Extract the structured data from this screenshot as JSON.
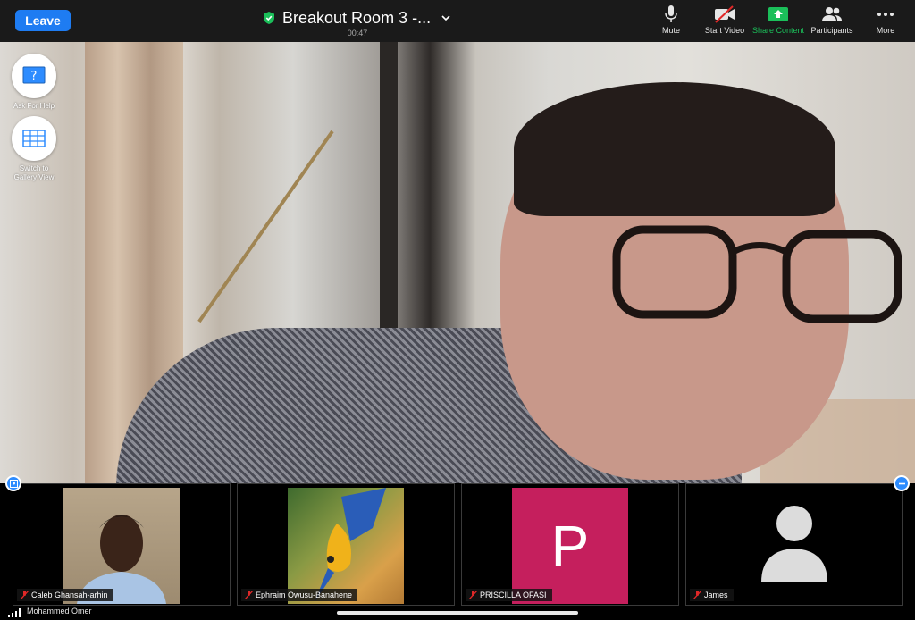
{
  "topbar": {
    "leave_label": "Leave",
    "room_title": "Breakout Room 3 -...",
    "timer": "00:47",
    "buttons": [
      {
        "label": "Mute",
        "icon": "microphone-icon"
      },
      {
        "label": "Start Video",
        "icon": "video-off-icon"
      },
      {
        "label": "Share Content",
        "icon": "share-screen-icon"
      },
      {
        "label": "Participants",
        "icon": "participants-icon"
      },
      {
        "label": "More",
        "icon": "more-dots-icon"
      }
    ]
  },
  "side": {
    "ask_help": "Ask For Help",
    "gallery": "Switch to\nGallery View"
  },
  "thumbnails": [
    {
      "name": "Caleb Ghansah-arhin",
      "type": "video"
    },
    {
      "name": "Ephraim Owusu-Banahene",
      "type": "image"
    },
    {
      "name": "PRISCILLA OFASI",
      "type": "initial",
      "initial": "P"
    },
    {
      "name": "James",
      "type": "avatar"
    }
  ],
  "self": {
    "name": "Mohammed Omer"
  },
  "colors": {
    "accent": "#1e7cf2",
    "share_green": "#1bbf5a",
    "avatar_p": "#c51f5d",
    "muted_red": "#e02828"
  }
}
